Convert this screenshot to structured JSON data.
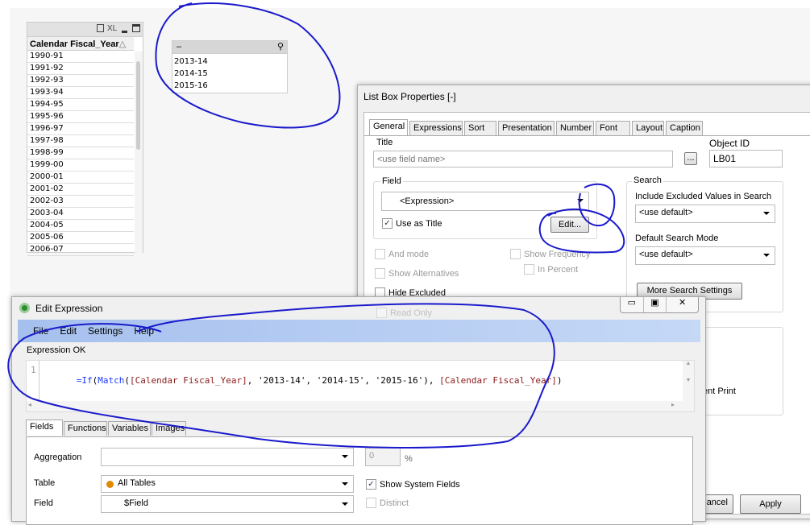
{
  "listbox1": {
    "header": "Calendar Fiscal_Year",
    "icons": [
      "print-icon",
      "xl-icon",
      "minimize-icon",
      "maximize-icon"
    ],
    "xl_label": "XL",
    "rows": [
      "1990-91",
      "1991-92",
      "1992-93",
      "1993-94",
      "1994-95",
      "1995-96",
      "1996-97",
      "1997-98",
      "1998-99",
      "1999-00",
      "2000-01",
      "2001-02",
      "2002-03",
      "2003-04",
      "2004-05",
      "2005-06",
      "2006-07"
    ]
  },
  "listbox2": {
    "title": "–",
    "rows": [
      "2013-14",
      "2014-15",
      "2015-16"
    ]
  },
  "props": {
    "title": "List Box Properties [-]",
    "tabs": [
      "General",
      "Expressions",
      "Sort",
      "Presentation",
      "Number",
      "Font",
      "Layout",
      "Caption"
    ],
    "active_tab": "General",
    "title_label": "Title",
    "title_placeholder": "<use field name>",
    "dots": "...",
    "object_id_label": "Object ID",
    "object_id": "LB01",
    "field_label": "Field",
    "field_value": "<Expression>",
    "use_as_title": "Use as Title",
    "use_as_title_checked": true,
    "edit_button": "Edit...",
    "and_mode": "And mode",
    "show_frequency": "Show Frequency",
    "in_percent": "In Percent",
    "show_alternatives": "Show Alternatives",
    "hide_excluded": "Hide Excluded",
    "read_only": "Read Only",
    "search_label": "Search",
    "include_excluded_label": "Include Excluded Values in Search",
    "include_excluded_value": "<use default>",
    "default_search_mode_label": "Default Search Mode",
    "default_search_mode_value": "<use default>",
    "more_search_button": "More Search Settings",
    "partial_text": "ent Print",
    "cancel_button": "Cancel",
    "apply_button": "Apply"
  },
  "editor": {
    "title": "Edit Expression",
    "menu": [
      "File",
      "Edit",
      "Settings",
      "Help"
    ],
    "status": "Expression OK",
    "line_number": "1",
    "expr": {
      "eq": "=",
      "fn1": "If",
      "p1": "(",
      "fn2": "Match",
      "p2": "(",
      "field1": "[Calendar Fiscal_Year]",
      "rest": ", '2013-14', '2014-15', '2015-16'), ",
      "field2": "[Calendar Fiscal_Year]",
      "end": ")"
    },
    "tabs": [
      "Fields",
      "Functions",
      "Variables",
      "Images"
    ],
    "active_tab": "Fields",
    "aggregation_label": "Aggregation",
    "aggregation_value": "",
    "percent_value": "0",
    "percent_sign": "%",
    "table_label": "Table",
    "table_value": "All Tables",
    "show_system_fields": "Show System Fields",
    "show_system_fields_checked": true,
    "field_label": "Field",
    "field_value": "$Field",
    "distinct": "Distinct"
  },
  "colors": {
    "annotation": "#1a1acc",
    "menu_bar": "#a9c4ef",
    "keyword": "#1e3cff",
    "field": "#8b1a1a",
    "table_dot": "#e08a00"
  }
}
